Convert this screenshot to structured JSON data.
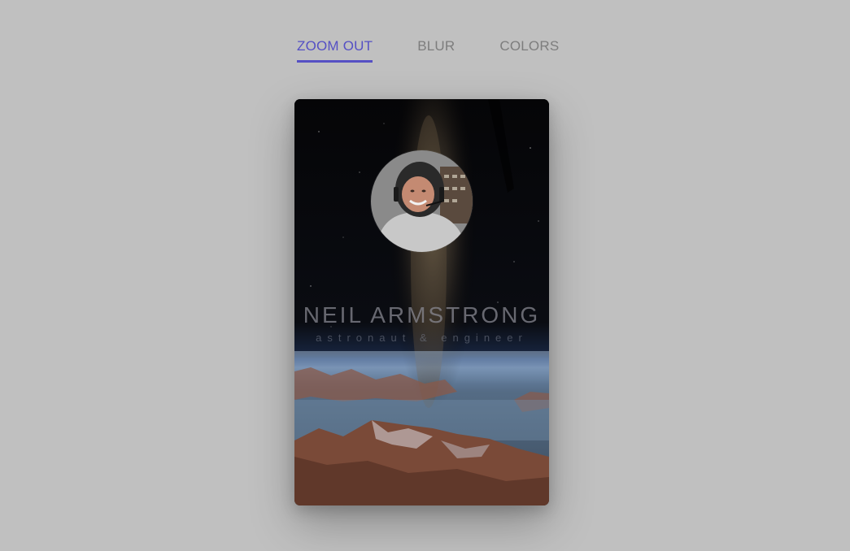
{
  "tabs": [
    {
      "label": "ZOOM OUT",
      "active": true
    },
    {
      "label": "BLUR",
      "active": false
    },
    {
      "label": "COLORS",
      "active": false
    }
  ],
  "card": {
    "name": "NEIL ARMSTRONG",
    "subtitle": "astronaut & engineer"
  },
  "colors": {
    "accent": "#5550c4",
    "tab_inactive": "#7d7d7d",
    "background": "#c0c0c0"
  },
  "icons": [
    "profile-photo",
    "space-background"
  ]
}
